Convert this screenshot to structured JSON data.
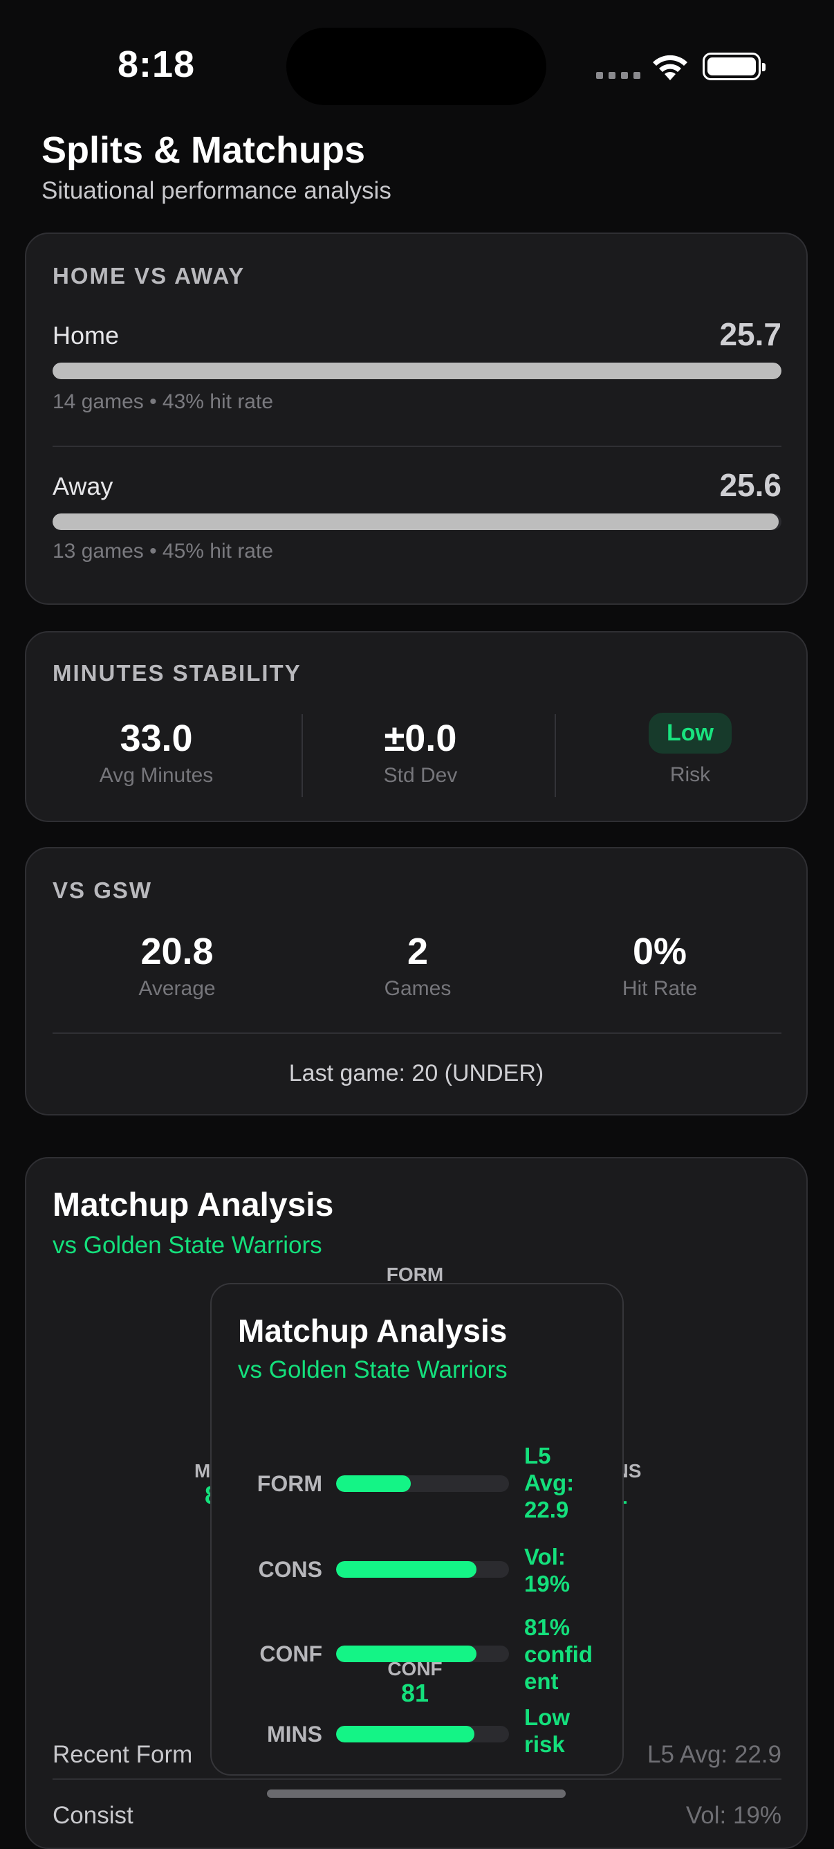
{
  "status": {
    "time": "8:18"
  },
  "header": {
    "title": "Splits & Matchups",
    "subtitle": "Situational performance analysis"
  },
  "home_away": {
    "heading": "HOME VS AWAY",
    "rows": [
      {
        "label": "Home",
        "value": "25.7",
        "meta": "14 games • 43% hit rate",
        "fill_pct": 100
      },
      {
        "label": "Away",
        "value": "25.6",
        "meta": "13 games • 45% hit rate",
        "fill_pct": 99.6
      }
    ]
  },
  "minutes": {
    "heading": "MINUTES STABILITY",
    "avg_value": "33.0",
    "avg_label": "Avg Minutes",
    "std_value": "±0.0",
    "std_label": "Std Dev",
    "risk_value": "Low",
    "risk_label": "Risk"
  },
  "vs": {
    "heading": "VS GSW",
    "avg_value": "20.8",
    "avg_label": "Average",
    "games_value": "2",
    "games_label": "Games",
    "hit_value": "0%",
    "hit_label": "Hit Rate",
    "last_game": "Last game: 20 (UNDER)"
  },
  "matchup": {
    "title": "Matchup Analysis",
    "subtitle": "vs Golden State Warriors",
    "radar": [
      {
        "name": "FORM",
        "score": "43"
      },
      {
        "name": "MINS",
        "score": "80"
      },
      {
        "name": "CONS",
        "score": "81"
      },
      {
        "name": "CONF",
        "score": "81"
      }
    ],
    "overlay": {
      "title": "Matchup Analysis",
      "subtitle": "vs Golden State Warriors",
      "metrics": [
        {
          "label": "FORM",
          "level_pct": 43,
          "note_lines": [
            "L5",
            "Avg:",
            "22.9"
          ]
        },
        {
          "label": "CONS",
          "level_pct": 81,
          "note_lines": [
            "Vol:",
            "19%"
          ]
        },
        {
          "label": "CONF",
          "level_pct": 81,
          "note_lines": [
            "81%",
            "confid",
            "ent"
          ]
        },
        {
          "label": "MINS",
          "level_pct": 80,
          "note_lines": [
            "Low",
            "risk"
          ]
        }
      ]
    },
    "recent_form_label": "Recent Form",
    "recent_form_value": "L5 Avg: 22.9",
    "partial_row_label": "Consist",
    "partial_row_value": "Vol: 19%"
  },
  "colors": {
    "accent": "#14e07c",
    "negative": "#f0134f",
    "bar": "#bdbdbd"
  }
}
